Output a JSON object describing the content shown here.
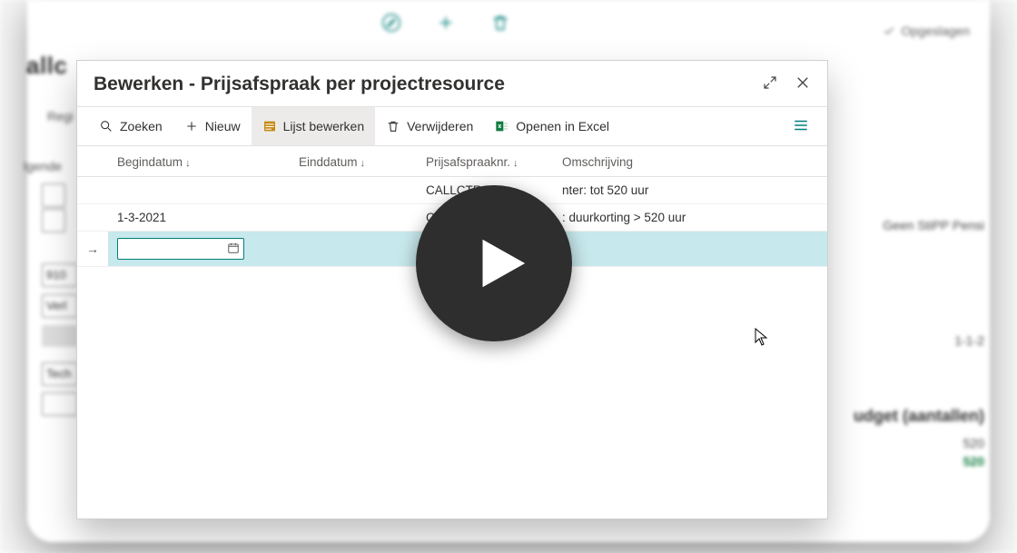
{
  "background": {
    "title_fragment": "allc",
    "saved": "Opgeslagen",
    "labels": {
      "regi": "Regi",
      "lgende": "lgende",
      "num": "910",
      "verl": "Verl",
      "tech": "Tech"
    },
    "right": {
      "stipp": "Geen StiPP Pensi",
      "date": "1-1-2",
      "heading": "udget (aantallen)",
      "v1": "520",
      "v2": "520"
    }
  },
  "modal": {
    "title": "Bewerken - Prijsafspraak per projectresource",
    "toolbar": {
      "zoeken": "Zoeken",
      "nieuw": "Nieuw",
      "lijst": "Lijst bewerken",
      "verwijderen": "Verwijderen",
      "excel": "Openen in Excel"
    },
    "columns": {
      "begin": "Begindatum",
      "eind": "Einddatum",
      "nr": "Prijsafspraaknr.",
      "omsch": "Omschrijving"
    },
    "rows": [
      {
        "begin": "",
        "eind": "",
        "nr": "CALLCTR",
        "omsch_suffix": "nter: tot 520 uur"
      },
      {
        "begin": "1-3-2021",
        "eind": "",
        "nr": "CALL",
        "omsch_suffix": ": duurkorting > 520 uur"
      },
      {
        "begin": "",
        "eind": "",
        "nr": "",
        "omsch_suffix": ""
      }
    ]
  }
}
